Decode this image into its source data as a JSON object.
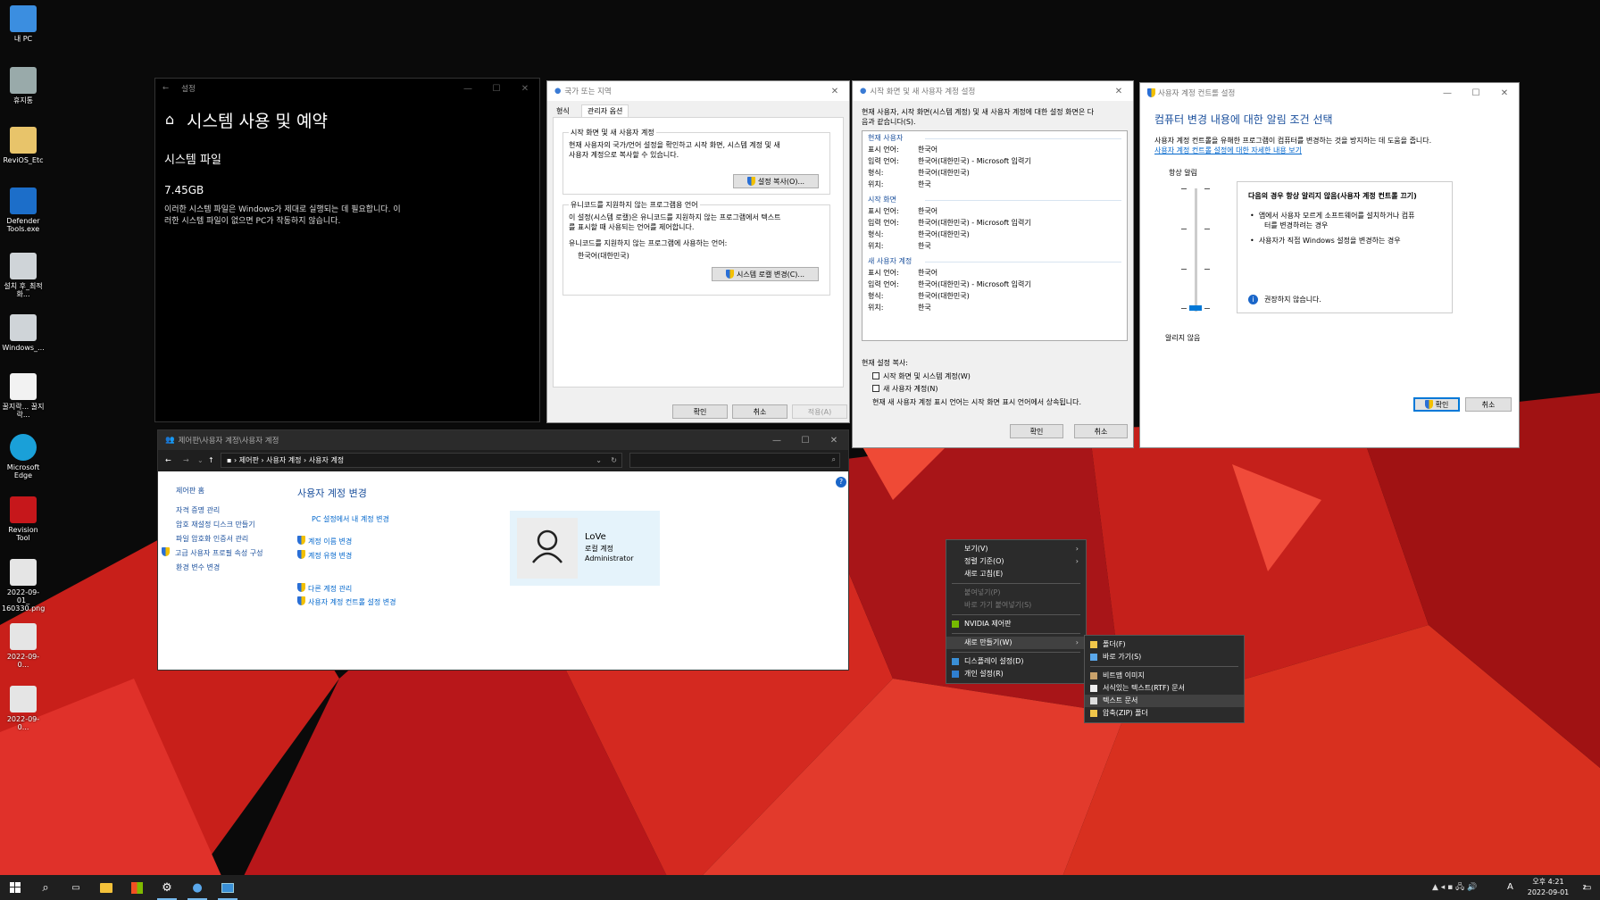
{
  "desktop_icons": [
    {
      "label": "내 PC",
      "icon": "computer-icon"
    },
    {
      "label": "휴지통",
      "icon": "recycle-bin-icon"
    },
    {
      "label": "ReviOS_Etc",
      "icon": "folder-icon"
    },
    {
      "label": "Defender Tools.exe",
      "icon": "shield-app-icon"
    },
    {
      "label": "설치 후_최적화...",
      "icon": "gear-file-icon"
    },
    {
      "label": "Windows_...",
      "icon": "gear-file-icon"
    },
    {
      "label": "꿀지락... 꿀지락...",
      "icon": "script-file-icon"
    },
    {
      "label": "Microsoft Edge",
      "icon": "edge-icon"
    },
    {
      "label": "Revision Tool",
      "icon": "revision-icon"
    },
    {
      "label": "2022-09-01_ 160330.png",
      "icon": "image-file-icon"
    },
    {
      "label": "2022-09-0...",
      "icon": "image-file-icon"
    },
    {
      "label": "2022-09-0...",
      "icon": "image-file-icon"
    }
  ],
  "settings_window": {
    "title": "설정",
    "heading": "시스템 사용 및 예약",
    "section": "시스템 파일",
    "size": "7.45GB",
    "description_1": "이러한 시스템 파일은 Windows가 제대로 실행되는 데 필요합니다. 이",
    "description_2": "러한 시스템 파일이 없으면 PC가 작동하지 않습니다."
  },
  "region_window": {
    "title": "국가 또는 지역",
    "tabs": [
      "형식",
      "관리자 옵션"
    ],
    "group1_label": "시작 화면 및 새 사용자 계정",
    "group1_text_1": "현재 사용자의 국가/언어 설정을 확인하고 시작 화면, 시스템 계정 및 새",
    "group1_text_2": "사용자 계정으로 복사할 수 있습니다.",
    "copy_button": "설정 복사(O)...",
    "group2_label": "유니코드를 지원하지 않는 프로그램용 언어",
    "group2_text_1": "이 설정(시스템 로캘)은 유니코드를 지원하지 않는 프로그램에서 텍스트",
    "group2_text_2": "를 표시할 때 사용되는 언어를 제어합니다.",
    "group2_text_3": "유니코드를 지원하지 않는 프로그램에 사용하는 언어:",
    "current_lang": "한국어(대한민국)",
    "locale_button": "시스템 로캘 변경(C)...",
    "ok": "확인",
    "cancel": "취소",
    "apply": "적용(A)"
  },
  "welcome_window": {
    "title": "시작 화면 및 새 사용자 계정 설정",
    "intro_1": "현재 사용자, 시작 화면(시스템 계정) 및 새 사용자 계정에 대한 설정 화면은 다",
    "intro_2": "음과 같습니다(S).",
    "sections": [
      {
        "header": "현재 사용자",
        "rows": [
          [
            "표시 언어:",
            "한국어"
          ],
          [
            "입력 언어:",
            "한국어(대한민국) - Microsoft 입력기"
          ],
          [
            "형식:",
            "한국어(대한민국)"
          ],
          [
            "위치:",
            "한국"
          ]
        ]
      },
      {
        "header": "시작 화면",
        "rows": [
          [
            "표시 언어:",
            "한국어"
          ],
          [
            "입력 언어:",
            "한국어(대한민국) - Microsoft 입력기"
          ],
          [
            "형식:",
            "한국어(대한민국)"
          ],
          [
            "위치:",
            "한국"
          ]
        ]
      },
      {
        "header": "새 사용자 계정",
        "rows": [
          [
            "표시 언어:",
            "한국어"
          ],
          [
            "입력 언어:",
            "한국어(대한민국) - Microsoft 입력기"
          ],
          [
            "형식:",
            "한국어(대한민국)"
          ],
          [
            "위치:",
            "한국"
          ]
        ]
      }
    ],
    "copy_label": "현재 설정 복사:",
    "check1": "시작 화면 및 시스템 계정(W)",
    "check2": "새 사용자 계정(N)",
    "note": "현재 새 사용자 계정 표시 언어는 시작 화면 표시 언어에서 상속됩니다.",
    "ok": "확인",
    "cancel": "취소"
  },
  "uac_window": {
    "title": "사용자 계정 컨트롤 설정",
    "heading": "컴퓨터 변경 내용에 대한 알림 조건 선택",
    "desc": "사용자 계정 컨트롤을 유해한 프로그램이 컴퓨터를 변경하는 것을 방지하는 데 도움을 줍니다.",
    "link": "사용자 계정 컨트롤 설정에 대한 자세한 내용 보기",
    "top_label": "항상 알림",
    "bottom_label": "알리지 않음",
    "slider_level": 0,
    "box_title": "다음의 경우 항상 알리지 않음(사용자 계정 컨트롤 끄기)",
    "bullet1_1": "앱에서 사용자 모르게 소프트웨어를 설치하거나 컴퓨",
    "bullet1_2": "터를 변경하려는 경우",
    "bullet2": "사용자가 직접 Windows 설정을 변경하는 경우",
    "warning": "권장하지 않습니다.",
    "ok": "확인",
    "cancel": "취소"
  },
  "cp_window": {
    "title": "제어판\\사용자 계정\\사용자 계정",
    "breadcrumb": [
      "제어판",
      "사용자 계정",
      "사용자 계정"
    ],
    "side_home": "제어판 홈",
    "side_links": [
      "자격 증명 관리",
      "암호 재설정 디스크 만들기",
      "파일 암호화 인증서 관리",
      "고급 사용자 프로필 속성 구성",
      "환경 변수 변경"
    ],
    "heading": "사용자 계정 변경",
    "pc_link": "PC 설정에서 내 계정 변경",
    "links1": [
      "계정 이름 변경",
      "계정 유형 변경"
    ],
    "links2": [
      "다른 계정 관리",
      "사용자 계정 컨트롤 설정 변경"
    ],
    "user_name": "LoVe",
    "user_type": "로컬 계정",
    "user_role": "Administrator"
  },
  "context_menu": {
    "items": [
      {
        "label": "보기(V)",
        "arrow": true
      },
      {
        "label": "정렬 기준(O)",
        "arrow": true
      },
      {
        "label": "새로 고침(E)"
      },
      {
        "sep": true
      },
      {
        "label": "붙여넣기(P)",
        "disabled": true
      },
      {
        "label": "바로 가기 붙여넣기(S)",
        "disabled": true
      },
      {
        "sep": true
      },
      {
        "label": "NVIDIA 제어판",
        "icon": "nvidia-icon"
      },
      {
        "sep": true
      },
      {
        "label": "새로 만들기(W)",
        "arrow": true,
        "highlight": true
      },
      {
        "sep": true
      },
      {
        "label": "디스플레이 설정(D)",
        "icon": "display-icon"
      },
      {
        "label": "개인 설정(R)",
        "icon": "personalize-icon"
      }
    ]
  },
  "submenu": {
    "items": [
      {
        "label": "폴더(F)",
        "icon": "folder-icon"
      },
      {
        "label": "바로 가기(S)",
        "icon": "shortcut-icon"
      },
      {
        "sep": true
      },
      {
        "label": "비트맵 이미지",
        "icon": "bitmap-icon"
      },
      {
        "label": "서식있는 텍스트(RTF) 문서",
        "icon": "rtf-icon"
      },
      {
        "label": "텍스트 문서",
        "icon": "text-doc-icon",
        "highlight": true
      },
      {
        "label": "압축(ZIP) 폴더",
        "icon": "zip-folder-icon"
      }
    ]
  },
  "taskbar": {
    "time": "오후 4:21",
    "date": "2022-09-01",
    "ime": "A",
    "notif": "2"
  }
}
